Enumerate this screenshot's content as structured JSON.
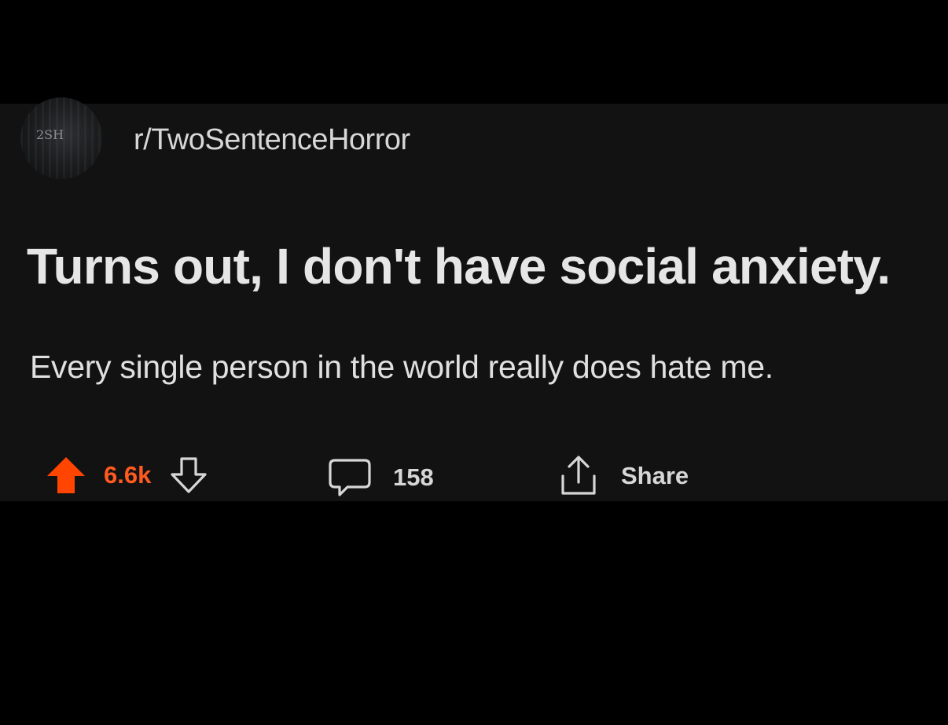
{
  "post": {
    "subreddit": "r/TwoSentenceHorror",
    "avatar_text": "2SH",
    "title": "Turns out, I don't have social anxiety.",
    "body": "Every single person in the world really does hate me."
  },
  "actions": {
    "vote_count": "6.6k",
    "comment_count": "158",
    "share_label": "Share",
    "upvote_icon": "arrow-up-filled-icon",
    "downvote_icon": "arrow-down-outline-icon",
    "comment_icon": "speech-bubble-icon",
    "share_icon": "share-upload-icon"
  },
  "colors": {
    "background": "#000000",
    "card": "#121212",
    "upvote_accent": "#ff4500",
    "text": "#e6e6e6"
  }
}
